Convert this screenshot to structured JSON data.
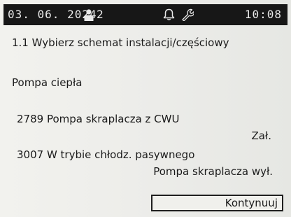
{
  "status_bar": {
    "date": "03. 06. 2024",
    "user_icon": "user-icon",
    "user_count": "2",
    "bell_icon": "bell-icon",
    "wrench_icon": "wrench-icon",
    "time": "10:08"
  },
  "screen": {
    "heading": "1.1 Wybierz schemat instalacji/częściowy",
    "section_title": "Pompa ciepła",
    "parameters": [
      {
        "label": "2789 Pompa skraplacza z CWU",
        "value": "Zał."
      },
      {
        "label": "3007 W trybie chłodz. pasywnego",
        "value": "Pompa skraplacza wył."
      }
    ]
  },
  "footer": {
    "continue_label": "Kontynuuj"
  },
  "colors": {
    "statusbar_bg": "#171717",
    "statusbar_fg": "#e8e8e8",
    "screen_bg": "#ededea",
    "text": "#1a1a1a"
  }
}
